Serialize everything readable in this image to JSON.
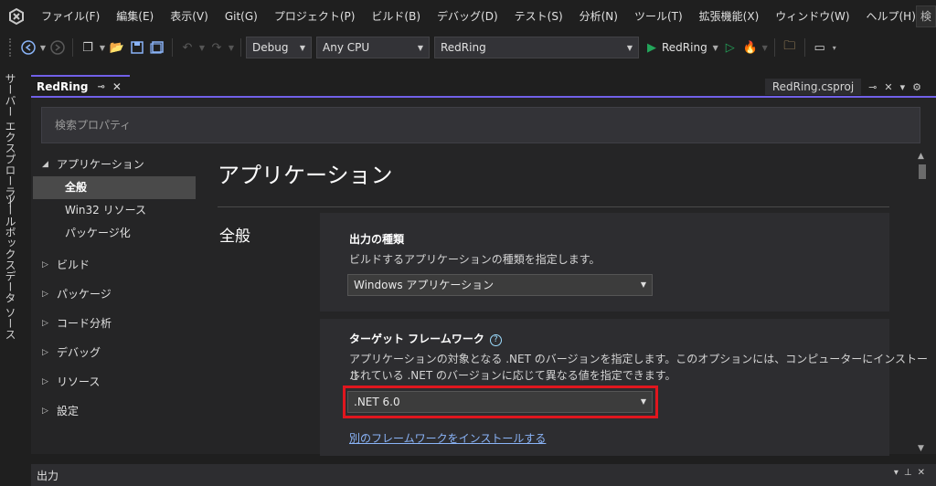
{
  "menu": {
    "items": [
      "ファイル(F)",
      "編集(E)",
      "表示(V)",
      "Git(G)",
      "プロジェクト(P)",
      "ビルド(B)",
      "デバッグ(D)",
      "テスト(S)",
      "分析(N)",
      "ツール(T)",
      "拡張機能(X)",
      "ウィンドウ(W)",
      "ヘルプ(H)"
    ],
    "search_label": "検"
  },
  "toolbar": {
    "configuration": "Debug",
    "platform": "Any CPU",
    "startup_project": "RedRing",
    "run_label": "RedRing"
  },
  "left_rail": {
    "tabs": [
      "サーバー エクスプローラー",
      "ツールボックス",
      "データ ソース"
    ]
  },
  "document_tab": {
    "title": "RedRing",
    "pin_icon": "pin-icon",
    "close_icon": "close-icon"
  },
  "right_tab": {
    "title": "RedRing.csproj"
  },
  "property_page": {
    "search_placeholder": "検索プロパティ",
    "nav": {
      "application": {
        "label": "アプリケーション",
        "children": [
          "全般",
          "Win32 リソース",
          "パッケージ化"
        ]
      },
      "collapsed": [
        "ビルド",
        "パッケージ",
        "コード分析",
        "デバッグ",
        "リソース",
        "設定"
      ]
    },
    "page_title": "アプリケーション",
    "section_title": "全般",
    "output_type": {
      "label": "出力の種類",
      "description": "ビルドするアプリケーションの種類を指定します。",
      "value": "Windows アプリケーション"
    },
    "target_framework": {
      "label": "ターゲット フレームワーク",
      "help": "?",
      "description_line1": "アプリケーションの対象となる .NET のバージョンを指定します。このオプションには、コンピューターにインストール",
      "description_line2": "されている .NET のバージョンに応じて異なる値を指定できます。",
      "value": ".NET 6.0",
      "install_link": "別のフレームワークをインストールする"
    }
  },
  "output_panel": {
    "title": "出力"
  },
  "colors": {
    "accent": "#7160e8",
    "highlight": "#e0161e",
    "run_green": "#23a55a",
    "link": "#8ab4f8"
  }
}
